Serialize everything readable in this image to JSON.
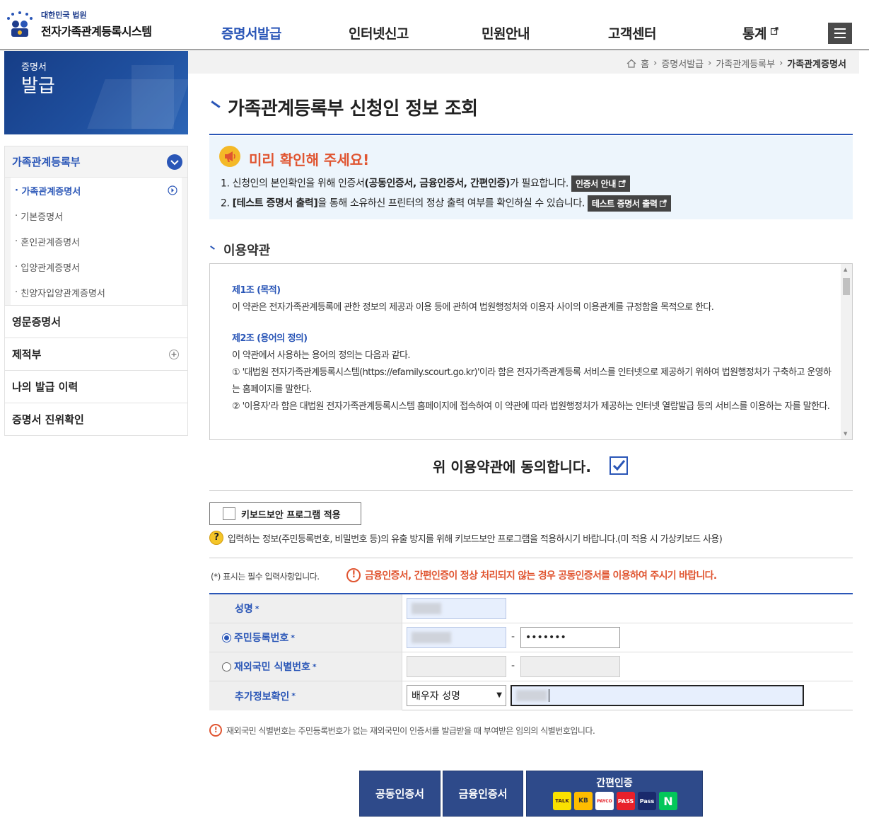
{
  "header": {
    "logo_sub": "대한민국 법원",
    "logo_main": "전자가족관계등록시스템",
    "nav": [
      "증명서발급",
      "인터넷신고",
      "민원안내",
      "고객센터",
      "통계"
    ],
    "nav_active": "증명서발급",
    "menu_icon": "hamburger-icon",
    "external_icon": "external-link-icon"
  },
  "side": {
    "banner_line1": "증명서",
    "banner_line2": "발급",
    "group_title": "가족관계등록부",
    "sub_items": [
      "가족관계증명서",
      "기본증명서",
      "혼인관계증명서",
      "입양관계증명서",
      "친양자입양관계증명서"
    ],
    "active_sub": "가족관계증명서",
    "menus": [
      "영문증명서",
      "제적부",
      "나의 발급 이력",
      "증명서 진위확인"
    ]
  },
  "breadcrumb": {
    "home": "홈",
    "items": [
      "증명서발급",
      "가족관계등록부",
      "가족관계증명서"
    ]
  },
  "page": {
    "title": "가족관계등록부 신청인 정보 조회"
  },
  "notice": {
    "title": "미리 확인해 주세요!",
    "line1_pre": "1. 신청인의 본인확인을 위해 인증서",
    "line1_bold": "(공동인증서, 금융인증서, 간편인증)",
    "line1_post": "가 필요합니다.",
    "btn1": "인증서 안내",
    "line2_num": "2. ",
    "line2_bold": "[테스트 증명서 출력]",
    "line2_post": "을 통해 소유하신 프린터의 정상 출력 여부를 확인하실 수 있습니다.",
    "btn2": "테스트 증명서 출력"
  },
  "terms": {
    "section_title": "이용약관",
    "a1_title": "제1조 (목적)",
    "a1_body": "이 약관은 전자가족관계등록에 관한 정보의 제공과 이용 등에 관하여 법원행정처와 이용자 사이의 이용관계를 규정함을 목적으로 한다.",
    "a2_title": "제2조 (용어의 정의)",
    "a2_body": "이 약관에서 사용하는 용어의 정의는 다음과 같다.",
    "a2_item1": "① '대법원 전자가족관계등록시스템(https://efamily.scourt.go.kr)'이라 함은 전자가족관계등록 서비스를 인터넷으로 제공하기 위하여 법원행정처가 구축하고 운영하는 홈페이지를 말한다.",
    "a2_item2": "② '이용자'라 함은 대법원 전자가족관계등록시스템 홈페이지에 접속하여 이 약관에 따라 법원행정처가 제공하는 인터넷 열람발급 등의 서비스를 이용하는 자를 말한다.",
    "agree_label": "위 이용약관에 동의합니다.",
    "agree_checked": true
  },
  "keyboard": {
    "label": "키보드보안 프로그램 적용",
    "note": "입력하는 정보(주민등록번호, 비밀번호 등)의 유출 방지를 위해 키보드보안 프로그램을 적용하시기 바랍니다.(미 적용 시 가상키보드 사용)"
  },
  "form": {
    "required_note": "(*) 표시는 필수 입력사항입니다.",
    "warning": "금융인증서, 간편인증이 정상 처리되지 않는 경우 공동인증서를 이용하여 주시기 바랍니다.",
    "name_label": "성명",
    "rrn_label": "주민등록번호",
    "rrn_back_value": "•••••••",
    "foreign_label": "재외국민 식별번호",
    "extra_label": "추가정보확인",
    "extra_select": "배우자 성명",
    "star": "*",
    "dash": "-",
    "foot_note": "재외국민 식별번호는 주민등록번호가 없는 재외국민이 인증서를 발급받을 때 부여받은 임의의 식별번호입니다."
  },
  "buttons": {
    "joint_cert": "공동인증서",
    "finance_cert": "금융인증서",
    "simple_auth": "간편인증",
    "providers": [
      "TALK",
      "KB",
      "PAYCO",
      "PASS",
      "Pass",
      "N"
    ]
  },
  "colors": {
    "primary": "#2a56b7",
    "warning": "#e05531",
    "button_bg": "#2e4a8a"
  }
}
